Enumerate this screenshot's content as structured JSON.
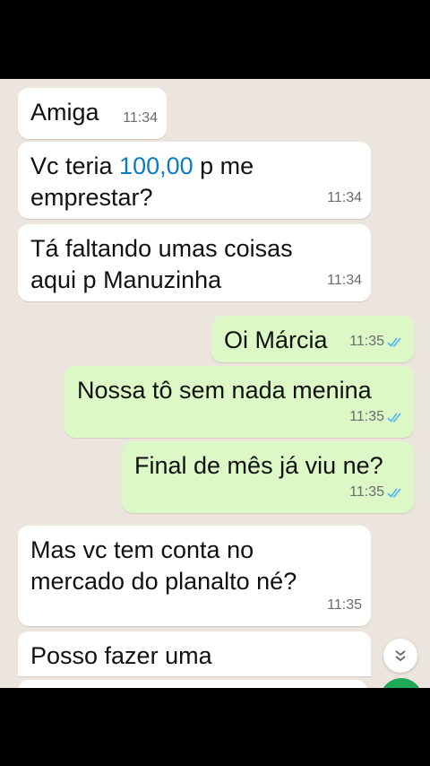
{
  "messages": [
    {
      "text": "Amiga",
      "time": "11:34"
    },
    {
      "text_before": "Vc teria ",
      "link": "100,00",
      "text_after": " p me\nemprestar?",
      "time": "11:34"
    },
    {
      "text": "Tá faltando umas coisas\naqui p Manuzinha",
      "time": "11:34"
    },
    {
      "text": "Oi Márcia",
      "time": "11:35"
    },
    {
      "text": "Nossa tô sem nada menina",
      "time": "11:35"
    },
    {
      "text": "Final de mês já viu ne?",
      "time": "11:35"
    },
    {
      "text": "Mas vc tem conta no\nmercado do planalto né?",
      "time": "11:35"
    },
    {
      "text": "Posso fazer uma"
    }
  ],
  "colors": {
    "chat_background": "#ece5dd",
    "incoming_bubble": "#ffffff",
    "outgoing_bubble": "#dcf8c6",
    "link": "#0a7cc2",
    "read_ticks": "#4fb6ec",
    "fab": "#1fa855"
  },
  "icons": {
    "read_receipt": "double-check-icon",
    "scroll": "chevron-double-down-icon"
  }
}
